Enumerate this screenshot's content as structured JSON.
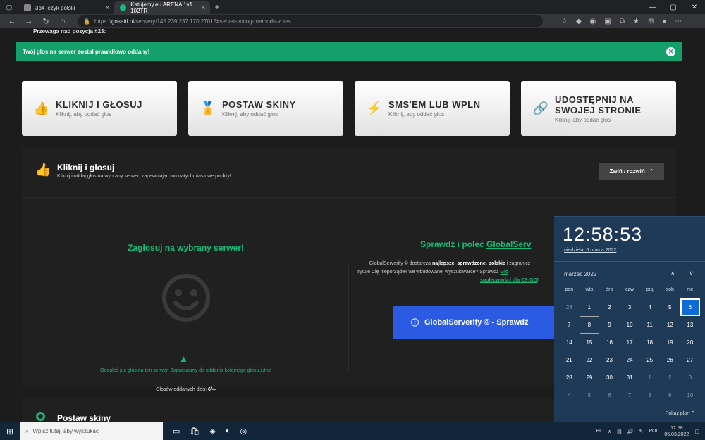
{
  "browser": {
    "tabs": [
      {
        "label": "3b4 język polski",
        "color": "#888888"
      },
      {
        "label": "Katujemy.eu ARENA 1v1 102TR",
        "color": "#17b978"
      }
    ],
    "url_prefix": "https://",
    "url_domain": "gosetti.pl",
    "url_path": "/serwery/145.239.237.170:27015#server-voting-methods-votes"
  },
  "page": {
    "advantage_label": "Przewaga nad pozycją #23:",
    "alert": "Twój głos na serwer został prawidłowo oddany!",
    "cards": [
      {
        "title": "KLIKNIJ I GŁOSUJ",
        "sub": "Kliknij, aby oddać głos",
        "icon": "thumbs-up-icon"
      },
      {
        "title": "POSTAW SKINY",
        "sub": "Kliknij, aby oddać głos",
        "icon": "award-icon"
      },
      {
        "title": "SMS'EM LUB WPLN",
        "sub": "Kliknij, aby oddać głos",
        "icon": "bolt-icon"
      },
      {
        "title": "UDOSTĘPNIJ NA SWOJEJ STRONIE",
        "sub": "Kliknij, aby oddać głos",
        "icon": "link-icon"
      }
    ],
    "section": {
      "title": "Kliknij i głosuj",
      "sub": "Kliknij i oddaj głos na wybrany serwer, zapewniając mu natychmiastowe punkty!",
      "toggle": "Zwiń / rozwiń"
    },
    "vote_title": "Zagłosuj na wybrany serwer!",
    "voted_msg": "Oddałeś już głos na ten serwer. Zapraszamy do oddania kolejnego głosu jutro!",
    "votes_today_label": "Głosów oddanych dziś:",
    "votes_today_value": "6/∞",
    "check_prefix": "Sprawdź i poleć",
    "check_link": "GlobalServ",
    "desc_1a": "GlobalServerify © dostarcza ",
    "desc_1b": "najlepsze, sprawdzone, polskie",
    "desc_1c": " i zagranicz",
    "desc_2a": "Irytuje Cię nieporządek we wbudowanej wyszukiwarce? Sprawdź ",
    "desc_2b": "Glo",
    "desc_3": "społeczności dla CS:GO",
    "gs_button": "GlobalServerify © - Sprawdź",
    "section2_title": "Postaw skiny"
  },
  "clock": {
    "time": "12:58:53",
    "date": "niedziela, 6 marca 2022",
    "month": "marzec 2022",
    "weekdays": [
      "pon",
      "wto",
      "śro",
      "czw",
      "pią",
      "sob",
      "nie"
    ],
    "days": [
      [
        "28",
        "1",
        "2",
        "3",
        "4",
        "5",
        "6"
      ],
      [
        "7",
        "8",
        "9",
        "10",
        "11",
        "12",
        "13"
      ],
      [
        "14",
        "15",
        "16",
        "17",
        "18",
        "19",
        "20"
      ],
      [
        "21",
        "22",
        "23",
        "24",
        "25",
        "26",
        "27"
      ],
      [
        "28",
        "29",
        "30",
        "31",
        "1",
        "2",
        "3"
      ],
      [
        "4",
        "5",
        "6",
        "7",
        "8",
        "9",
        "10"
      ]
    ],
    "show_plan": "Pokaż plan"
  },
  "taskbar": {
    "search_placeholder": "Wpisz tutaj, aby wyszukać",
    "lang": "PL",
    "lang2": "POL",
    "time": "12:58",
    "date": "06.03.2022"
  }
}
